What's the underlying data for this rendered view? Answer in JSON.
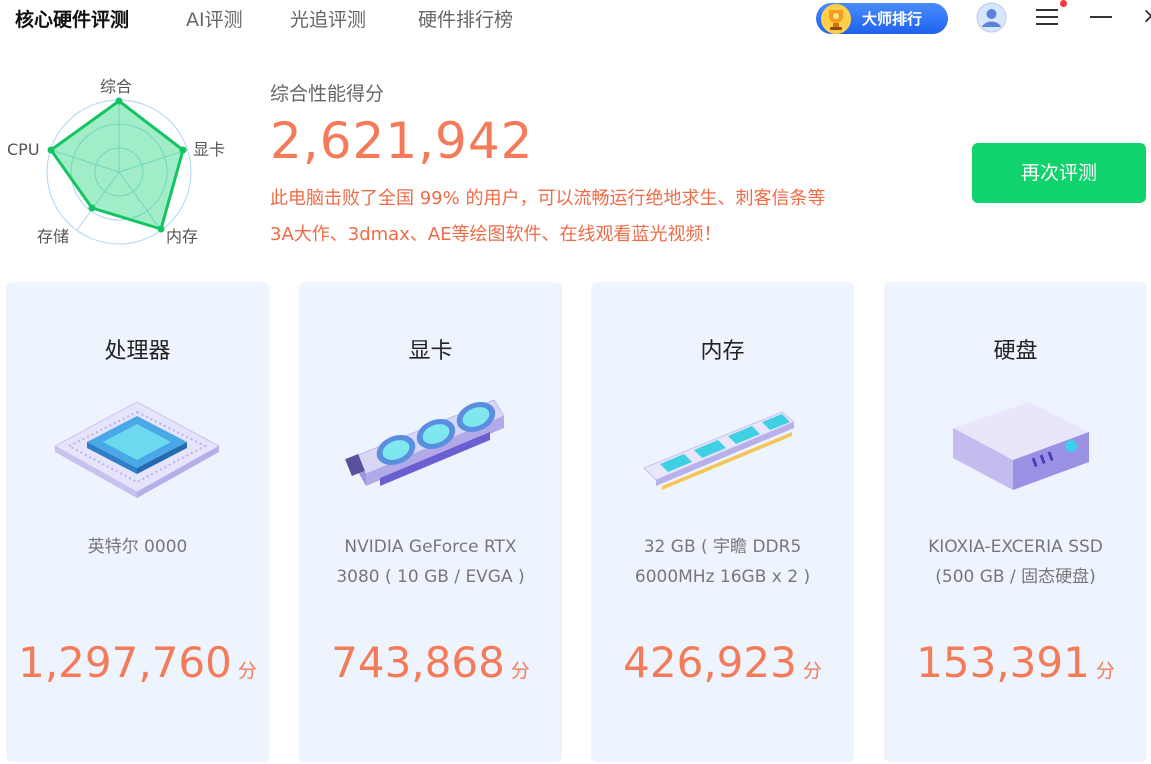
{
  "nav": {
    "tabs": [
      "核心硬件评测",
      "AI评测",
      "光追评测",
      "硬件排行榜"
    ],
    "master_rank_label": "大师排行"
  },
  "summary": {
    "radar_labels": [
      "综合",
      "显卡",
      "内存",
      "存储",
      "CPU"
    ],
    "title": "综合性能得分",
    "score": "2,621,942",
    "description_line1": "此电脑击败了全国 99% 的用户，可以流畅运行绝地求生、刺客信条等",
    "description_line2": "3A大作、3dmax、AE等绘图软件、在线观看蓝光视频！",
    "retest_label": "再次评测"
  },
  "cards": [
    {
      "title": "处理器",
      "name_line1": "英特尔 0000",
      "name_line2": "",
      "score": "1,297,760",
      "unit": "分"
    },
    {
      "title": "显卡",
      "name_line1": "NVIDIA GeForce RTX",
      "name_line2": "3080 ( 10 GB / EVGA )",
      "score": "743,868",
      "unit": "分"
    },
    {
      "title": "内存",
      "name_line1": "32 GB ( 宇瞻 DDR5",
      "name_line2": "6000MHz 16GB x 2 )",
      "score": "426,923",
      "unit": "分"
    },
    {
      "title": "硬盘",
      "name_line1": "KIOXIA-EXCERIA SSD",
      "name_line2": "(500 GB / 固态硬盘)",
      "score": "153,391",
      "unit": "分"
    }
  ],
  "colors": {
    "accent_orange": "#f37b59",
    "retest_green": "#10d36c",
    "master_blue": "#1f62ee",
    "card_bg": "#eef4fd"
  }
}
